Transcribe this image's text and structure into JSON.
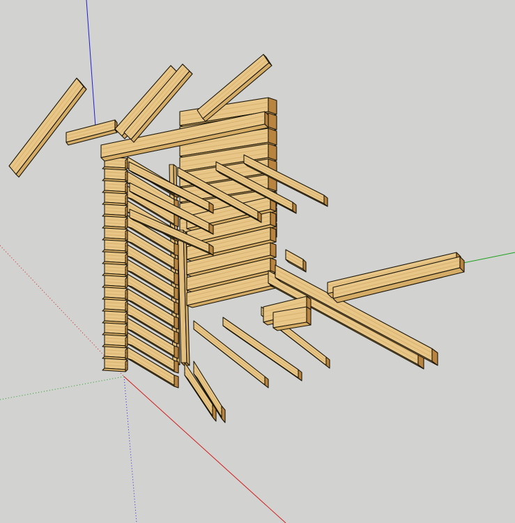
{
  "window": {
    "title": ""
  },
  "viewport": {
    "background": "#d2d2d0",
    "axes": {
      "red": "#d21e1e",
      "green": "#1ea11e",
      "blue": "#1e1ed2"
    }
  },
  "model": {
    "material": "wood",
    "colors": {
      "top": "#e7c687",
      "side": "#d5ac66",
      "end": "#b8843f",
      "edge": "#1b1608",
      "grain": "#c89a52"
    }
  }
}
